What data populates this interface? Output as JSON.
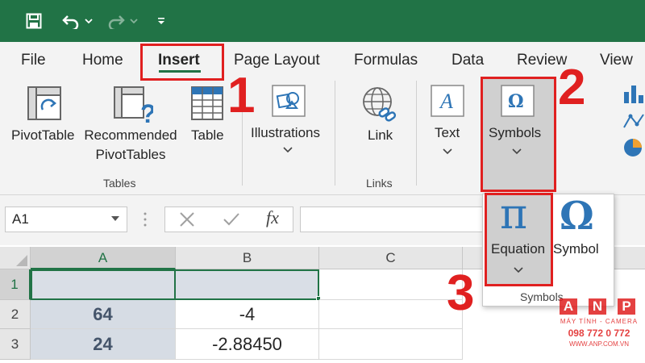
{
  "tabs": [
    "File",
    "Home",
    "Insert",
    "Page Layout",
    "Formulas",
    "Data",
    "Review",
    "View"
  ],
  "ribbon": {
    "pivottable": "PivotTable",
    "recommended_1": "Recommended",
    "recommended_2": "PivotTables",
    "table": "Table",
    "illustrations": "Illustrations",
    "link": "Link",
    "text": "Text",
    "symbols": "Symbols",
    "group_tables": "Tables",
    "group_links": "Links"
  },
  "formula_bar": {
    "name_box": "A1",
    "cancel_icon": "x-icon",
    "enter_icon": "check-icon",
    "fx": "fx"
  },
  "grid": {
    "columns": [
      "A",
      "B",
      "C"
    ],
    "rows": [
      {
        "num": "1",
        "a": "",
        "b": ""
      },
      {
        "num": "2",
        "a": "64",
        "b": "-4"
      },
      {
        "num": "3",
        "a": "24",
        "b": "-2.88450"
      }
    ]
  },
  "dropdown": {
    "equation": "Equation",
    "symbol": "Symbol",
    "group": "Symbols",
    "pi_glyph": "π",
    "omega_glyph": "Ω"
  },
  "annotations": {
    "step1": "1",
    "step2": "2",
    "step3": "3"
  },
  "watermark": {
    "letters": [
      "A",
      "N",
      "P"
    ],
    "tagline": "MÁY TÍNH - CAMERA",
    "phone": "098 772 0 772",
    "site": "WWW.ANP.COM.VN"
  },
  "colors": {
    "excel_green": "#217346",
    "annotation_red": "#e02020"
  }
}
